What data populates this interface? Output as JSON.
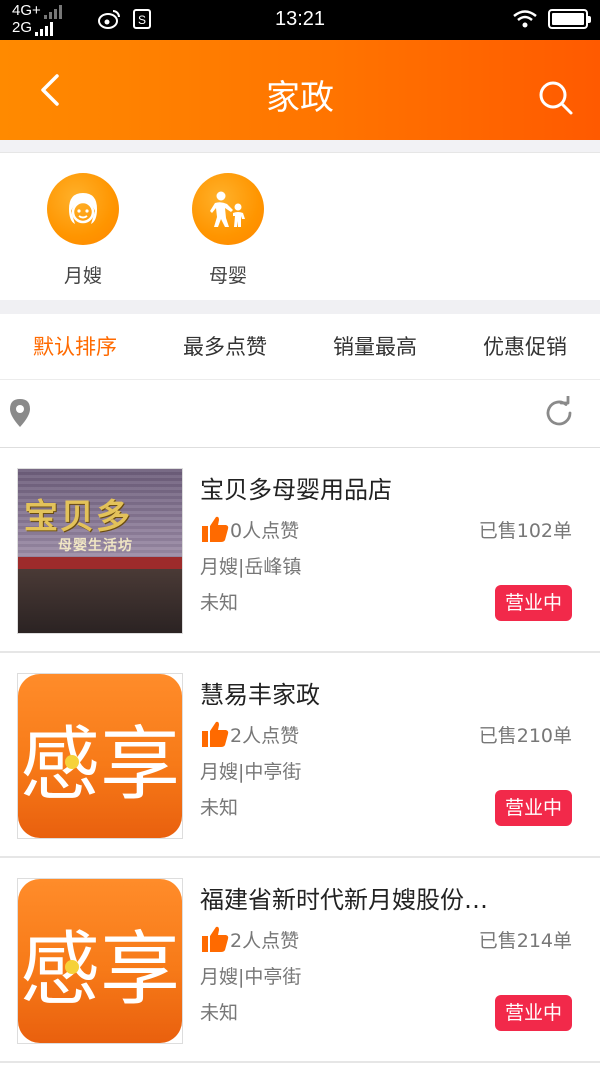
{
  "status_bar": {
    "network_top": "4G+",
    "network_bottom": "2G",
    "time": "13:21"
  },
  "header": {
    "title": "家政",
    "back_icon": "chevron-left-icon",
    "search_icon": "search-icon"
  },
  "categories": [
    {
      "label": "月嫂",
      "icon": "nanny-face-icon"
    },
    {
      "label": "母婴",
      "icon": "mother-child-icon"
    }
  ],
  "sort_tabs": [
    {
      "label": "默认排序",
      "active": true
    },
    {
      "label": "最多点赞",
      "active": false
    },
    {
      "label": "销量最高",
      "active": false
    },
    {
      "label": "优惠促销",
      "active": false
    }
  ],
  "stores": [
    {
      "name": "宝贝多母婴用品店",
      "likes": "0人点赞",
      "sold": "已售102单",
      "category_area": "月嫂|岳峰镇",
      "distance": "未知",
      "status": "营业中"
    },
    {
      "name": "慧易丰家政",
      "likes": "2人点赞",
      "sold": "已售210单",
      "category_area": "月嫂|中亭街",
      "distance": "未知",
      "status": "营业中"
    },
    {
      "name": "福建省新时代新月嫂股份…",
      "likes": "2人点赞",
      "sold": "已售214单",
      "category_area": "月嫂|中亭街",
      "distance": "未知",
      "status": "营业中"
    }
  ],
  "thumb_texts": {
    "sign_big": "宝贝多",
    "sign_sub": "母婴生活坊",
    "logo_char": "感享"
  },
  "colors": {
    "accent": "#ff6a00",
    "badge": "#f2294a",
    "icon_orange": "#ff9500"
  }
}
